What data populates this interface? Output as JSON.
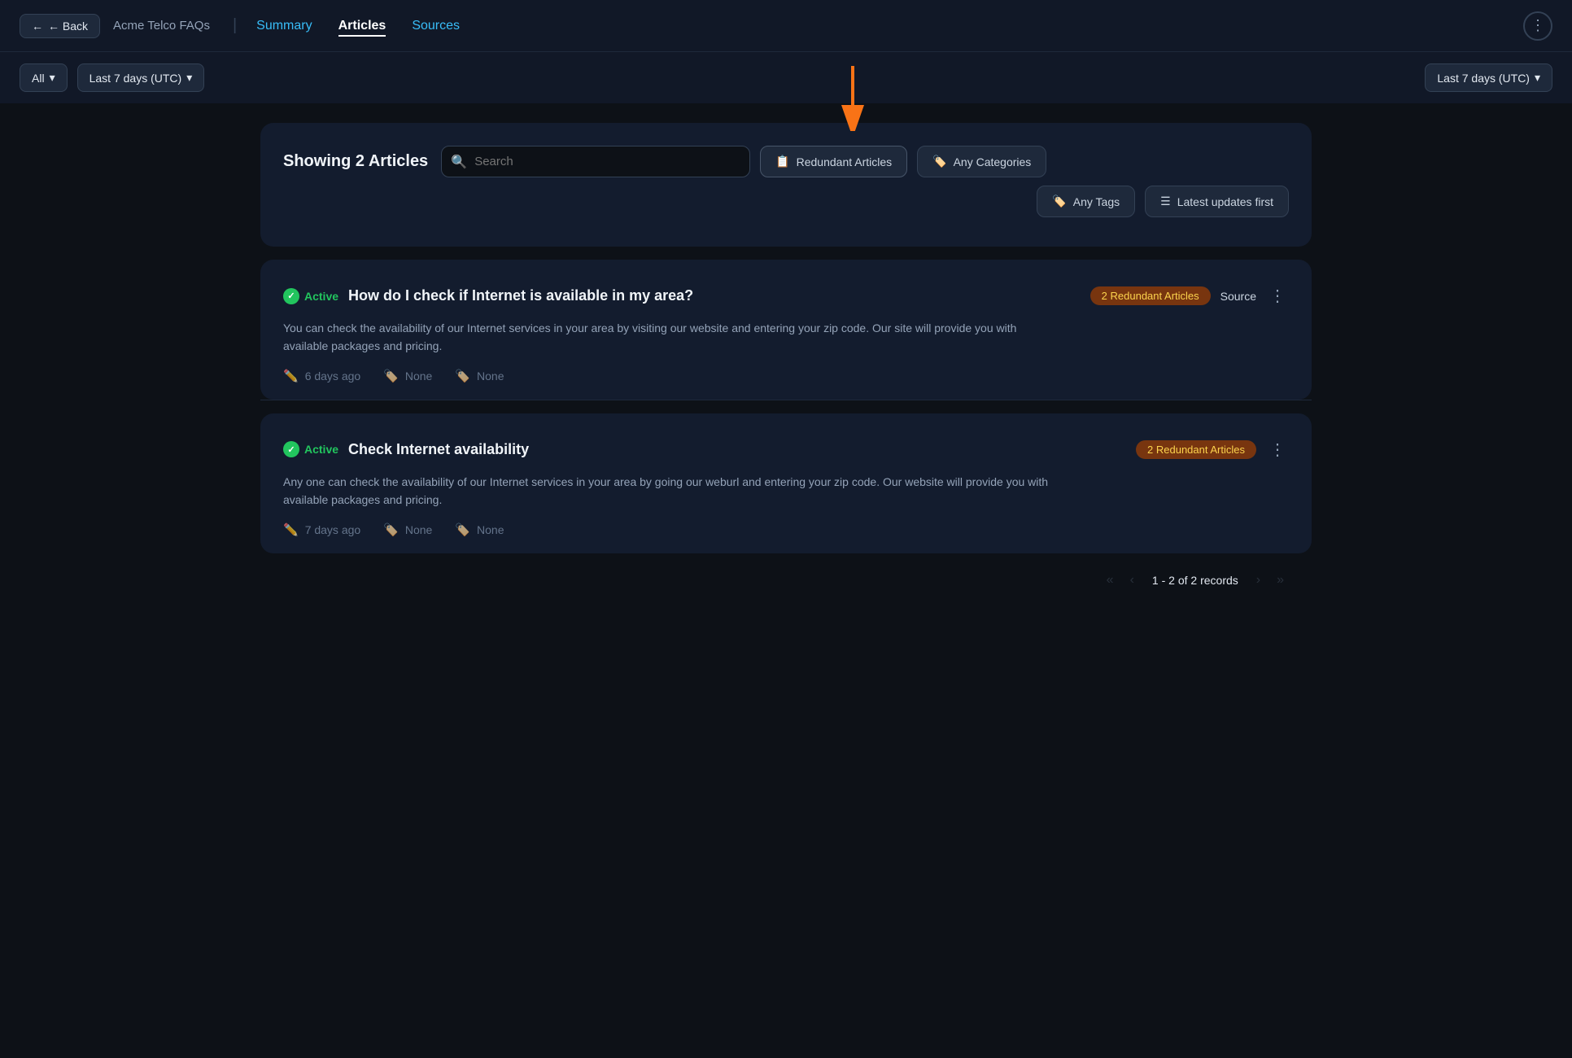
{
  "navbar": {
    "back_label": "← Back",
    "title": "Acme Telco FAQs",
    "tab_summary": "Summary",
    "tab_articles": "Articles",
    "tab_sources": "Sources",
    "more_icon": "⋮"
  },
  "filter_bar": {
    "filter1_label": "All",
    "filter1_chevron": "▾",
    "filter2_label": "Last 7 days (UTC)",
    "filter2_chevron": "▾",
    "filter_right_label": "Last 7 days (UTC)",
    "filter_right_chevron": "▾"
  },
  "search_section": {
    "showing_label": "Showing 2 Articles",
    "search_placeholder": "Search",
    "btn_redundant": "Redundant Articles",
    "btn_categories": "Any Categories",
    "btn_tags": "Any Tags",
    "btn_sort": "Latest updates first"
  },
  "articles": [
    {
      "status": "Active",
      "title": "How do I check if Internet is available in my area?",
      "redundant_count": "2 Redundant Articles",
      "source_label": "Source",
      "description": "You can check the availability of our Internet services in your area by visiting our website and entering your zip code. Our site will provide you with available packages and pricing.",
      "updated": "6 days ago",
      "category": "None",
      "tag": "None"
    },
    {
      "status": "Active",
      "title": "Check Internet availability",
      "redundant_count": "2 Redundant Articles",
      "source_label": "",
      "description": "Any one can check the availability of our Internet services in your area by going our weburl and entering your zip code. Our website will provide you with available packages and pricing.",
      "updated": "7 days ago",
      "category": "None",
      "tag": "None"
    }
  ],
  "pagination": {
    "range": "1 - 2",
    "total": "2",
    "unit": "records",
    "first_icon": "«",
    "prev_icon": "‹",
    "next_icon": "›",
    "last_icon": "»"
  }
}
